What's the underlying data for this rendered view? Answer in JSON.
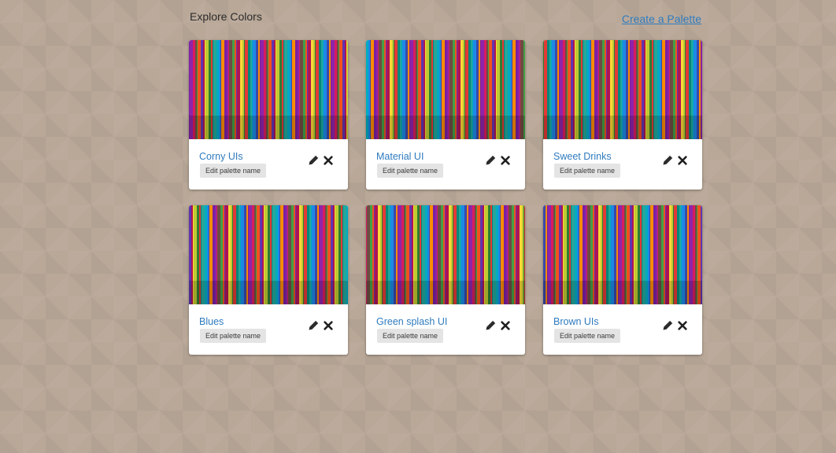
{
  "header": {
    "title": "Explore Colors",
    "create_link": "Create a Palette"
  },
  "edit_label": "Edit palette name",
  "palettes": [
    {
      "name": "Corny UIs"
    },
    {
      "name": "Material UI"
    },
    {
      "name": "Sweet Drinks"
    },
    {
      "name": "Blues"
    },
    {
      "name": "Green splash UI"
    },
    {
      "name": "Brown UIs"
    }
  ],
  "icons": {
    "edit": "pencil-icon",
    "delete": "close-icon"
  },
  "colors": {
    "background": "#b9a898",
    "link": "#2f7bbf",
    "stripes": [
      "#7b1fa2",
      "#e53935",
      "#43a047",
      "#1e88e5",
      "#fdd835",
      "#8e24aa",
      "#00897b",
      "#f4511e",
      "#3949ab",
      "#c0ca33",
      "#d81b60",
      "#26a69a",
      "#5e35b1",
      "#fb8c00",
      "#2e7d32",
      "#6d4c41",
      "#00acc1",
      "#ad1457"
    ]
  }
}
